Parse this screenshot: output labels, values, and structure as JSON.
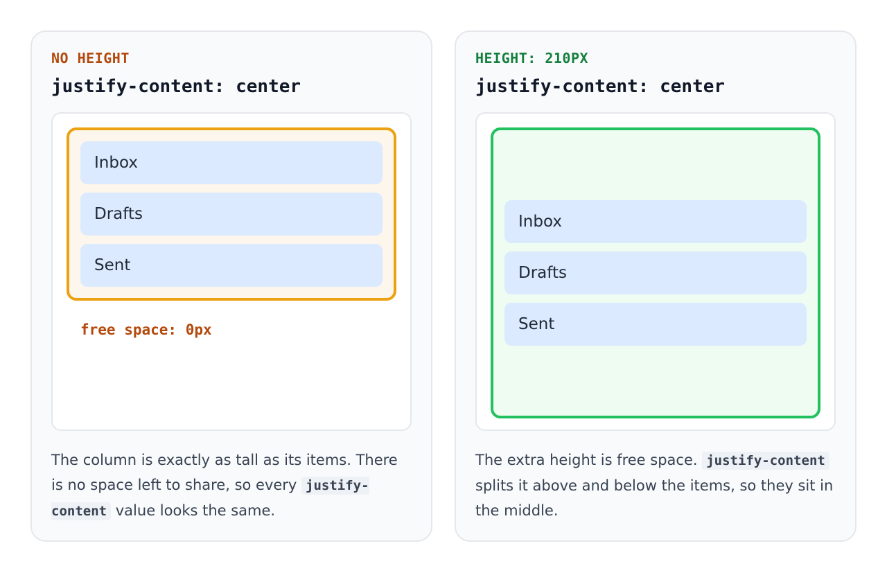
{
  "left": {
    "tag": "NO HEIGHT",
    "title": "justify-content: center",
    "items": [
      "Inbox",
      "Drafts",
      "Sent"
    ],
    "free_space": "free space: 0px",
    "caption": {
      "text_1": "The column is exactly as tall as its items. There is no space left to share, so every ",
      "code": "justify-content",
      "text_2": " value looks the same."
    }
  },
  "right": {
    "tag": "HEIGHT: 210PX",
    "title": "justify-content: center",
    "items": [
      "Inbox",
      "Drafts",
      "Sent"
    ],
    "caption": {
      "text_1": "The extra height is free space. ",
      "code": "justify-content",
      "text_2": " splits it above and below the items, so they sit in the middle."
    }
  },
  "colors": {
    "warn_accent": "#eba112",
    "ok_accent": "#22c05e",
    "item_bg": "#dbeafe"
  }
}
